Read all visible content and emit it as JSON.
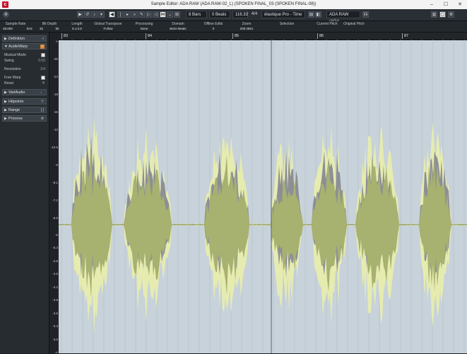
{
  "window": {
    "title": "Sample Editor: ADA RAW (ADA RAW-02_L) (SPOKEN FINAL_03 (SPOKEN FINAL-08))",
    "controls": [
      "–",
      "☐",
      "✕"
    ]
  },
  "toolbar": {
    "length_bars": "8 Bars",
    "beats": "0 Beats",
    "tempo": "116.33",
    "signature": "4/4",
    "algorithm": "élastique Pro - Time",
    "audio_name": "ADA RAW (ADA..."
  },
  "info_line": [
    {
      "label": "Sample Rate",
      "value": "48.000"
    },
    {
      "label": "",
      "value": "kHz"
    },
    {
      "label": "Bit Depth",
      "value": "32"
    },
    {
      "label": "",
      "value": "bit"
    },
    {
      "label": "Length",
      "value": "8.1.0.5"
    },
    {
      "label": "Global Transpose",
      "value": "Follow"
    },
    {
      "label": "Processing",
      "value": "None"
    },
    {
      "label": "Domain",
      "value": "Bars+Beats"
    },
    {
      "label": "Offline Edits",
      "value": "0"
    },
    {
      "label": "Zoom",
      "value": "209.2561"
    },
    {
      "label": "Selection",
      "value": ""
    },
    {
      "label": "Current Pitch",
      "value": ""
    },
    {
      "label": "Original Pitch",
      "value": ""
    }
  ],
  "inspector": {
    "definition": "Definition",
    "audiowarp": "AudioWarp",
    "musical_mode": "Musical Mode",
    "swing": "Swing",
    "swing_value": "0.00",
    "resolution": "Resolution",
    "resolution_value": "1/4",
    "free_warp": "Free Warp",
    "reset": "Reset",
    "variaudio": "VariAudio",
    "hitpoints": "Hitpoints",
    "range": "Range",
    "process": "Process"
  },
  "ruler": {
    "bars": [
      "83",
      "84",
      "85",
      "86",
      "87"
    ]
  },
  "amplitude_axis": [
    "∞",
    "-30",
    "-24",
    "-18",
    "-15",
    "-12",
    "-10.5",
    "-9",
    "-8.1",
    "-7.2",
    "-6.6",
    "-6",
    "-5.4",
    "-4.8",
    "-4.5",
    "-4.2",
    "-3.9",
    "-3.6",
    "-3.3",
    "-3.0",
    "-∞"
  ],
  "colors": {
    "wave_fill": "#e6ebb0",
    "wave_core": "#a7b170",
    "wave_grey": "#8c8f96",
    "wave_bg": "#c7d2da"
  }
}
